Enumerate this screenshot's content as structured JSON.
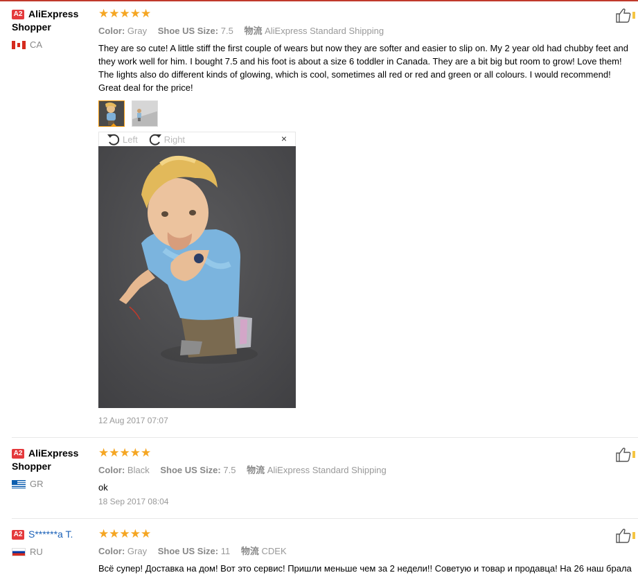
{
  "reviews": [
    {
      "badge": "A2",
      "user": "AliExpress Shopper",
      "country": "CA",
      "stars": "★★★★★",
      "color_label": "Color:",
      "color_value": "Gray",
      "size_label": "Shoe US Size:",
      "size_value": "7.5",
      "ship_label": "物流",
      "ship_value": "AliExpress Standard Shipping",
      "text": "They are so cute! A little stiff the first couple of wears but now they are softer and easier to slip on. My 2 year old had chubby feet and they work well for him. I bought 7.5 and his foot is about a size 6 toddler in Canada. They are a bit big but room to grow! Love them! The lights also do different kinds of glowing, which is cool, sometimes all red or red and green or all colours. I would recommend! Great deal for the price!",
      "date": "12 Aug 2017 07:07"
    },
    {
      "badge": "A2",
      "user": "AliExpress Shopper",
      "country": "GR",
      "stars": "★★★★★",
      "color_label": "Color:",
      "color_value": "Black",
      "size_label": "Shoe US Size:",
      "size_value": "7.5",
      "ship_label": "物流",
      "ship_value": "AliExpress Standard Shipping",
      "text": "ok",
      "date": "18 Sep 2017 08:04"
    },
    {
      "badge": "A2",
      "user": "S******a T.",
      "country": "RU",
      "stars": "★★★★★",
      "color_label": "Color:",
      "color_value": "Gray",
      "size_label": "Shoe US Size:",
      "size_value": "11",
      "ship_label": "物流",
      "ship_value": "CDEK",
      "text": "Всё супер! Доставка на дом! Вот это сервис! Пришли меньше чем за 2 недели!! Советую и товар и продавца! На 26 наш брала"
    }
  ],
  "viewer": {
    "left_label": "Left",
    "right_label": "Right",
    "close_label": "×"
  },
  "icons": {
    "like": "thumbs-up-icon",
    "rotate_left": "rotate-left-icon",
    "rotate_right": "rotate-right-icon",
    "close": "close-icon"
  },
  "colors": {
    "star": "#f5a623",
    "badge": "#e4393c",
    "accent_border": "#f39c12",
    "link": "#1b61b8"
  }
}
